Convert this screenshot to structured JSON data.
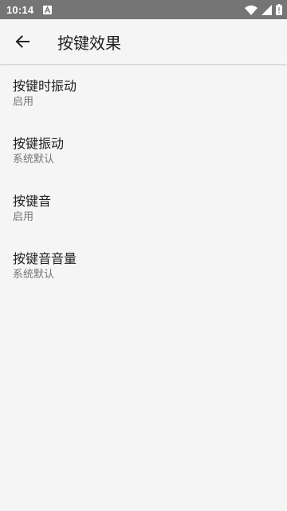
{
  "status_bar": {
    "time": "10:14",
    "icons": [
      "notification-a-icon",
      "wifi-icon",
      "cell-signal-icon",
      "battery-icon"
    ]
  },
  "app_bar": {
    "back_icon": "arrow-back-icon",
    "title": "按键效果"
  },
  "preferences": [
    {
      "title": "按键时振动",
      "summary": "启用"
    },
    {
      "title": "按键振动",
      "summary": "系统默认"
    },
    {
      "title": "按键音",
      "summary": "启用"
    },
    {
      "title": "按键音音量",
      "summary": "系统默认"
    }
  ],
  "colors": {
    "status_bar": "#757575",
    "background": "#f5f5f5",
    "title_text": "#212121",
    "summary_text": "#757575"
  }
}
